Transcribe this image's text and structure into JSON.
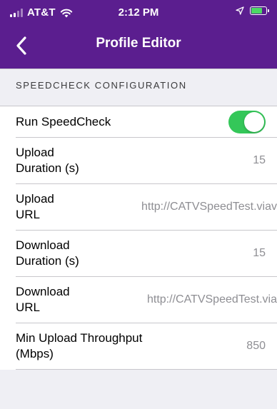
{
  "status_bar": {
    "carrier": "AT&T",
    "time": "2:12 PM",
    "battery_color": "#4cd964"
  },
  "nav": {
    "title": "Profile Editor",
    "back_icon": "chevron-left-icon",
    "background": "#5b1e8f"
  },
  "section": {
    "title": "SPEEDCHECK CONFIGURATION"
  },
  "rows": [
    {
      "label": "Run SpeedCheck",
      "toggle_on": true,
      "toggle_color": "#34c759"
    },
    {
      "label": "Upload Duration (s)",
      "value": "15"
    },
    {
      "label": "Upload URL",
      "value": "http://CATVSpeedTest.viav"
    },
    {
      "label": "Download Duration (s)",
      "value": "15"
    },
    {
      "label": "Download URL",
      "value": "http://CATVSpeedTest.via"
    },
    {
      "label": "Min Upload Throughput (Mbps)",
      "value": "850"
    }
  ]
}
